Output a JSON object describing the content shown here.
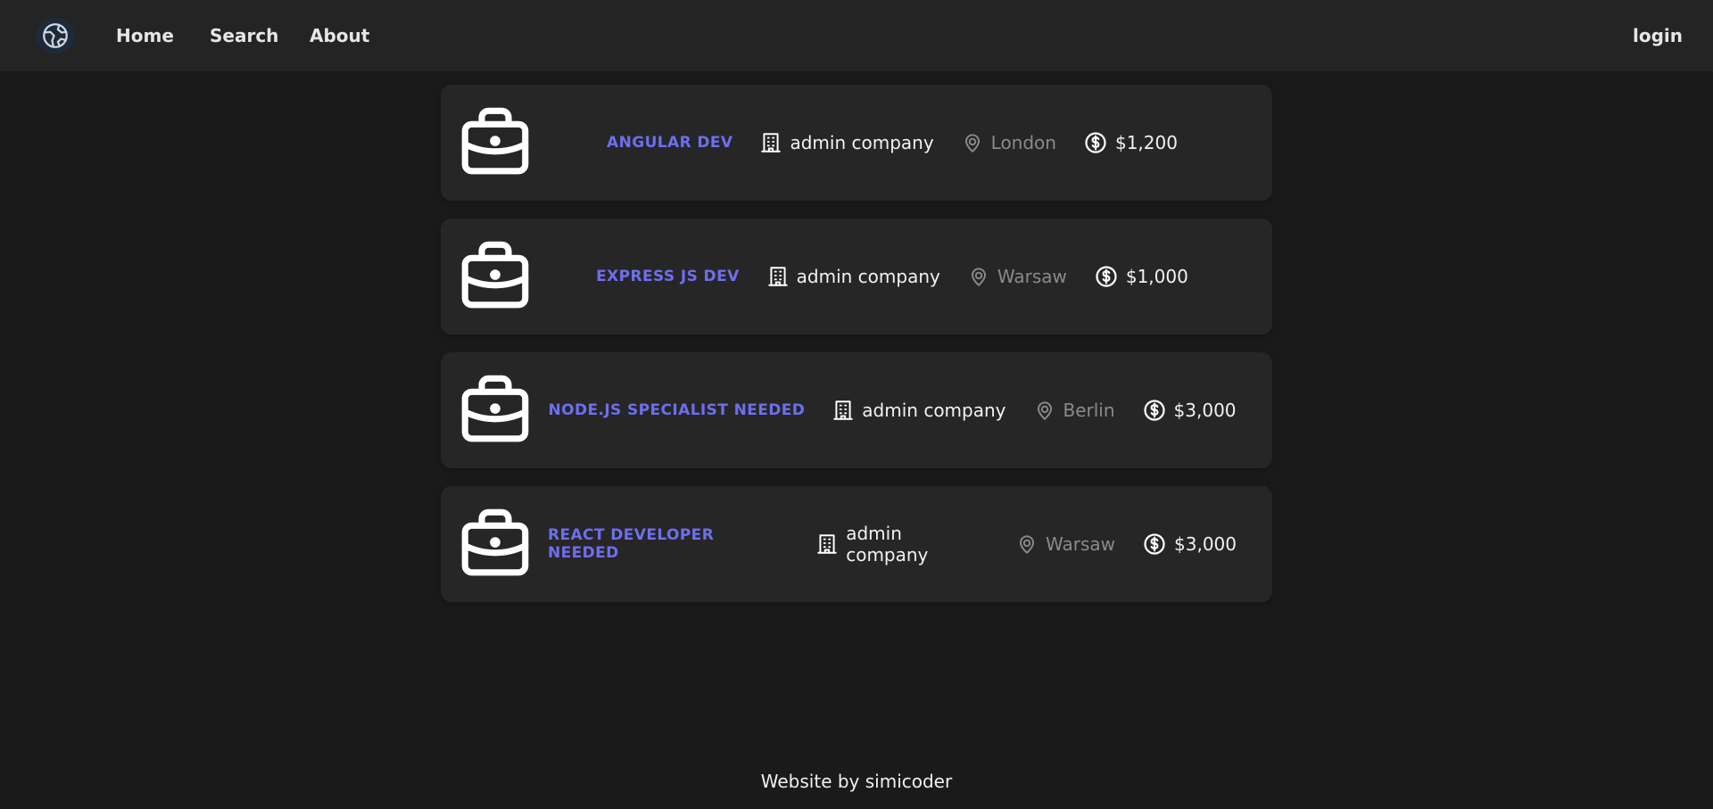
{
  "nav": {
    "logo_icon": "globe-logo-icon",
    "home": "Home",
    "search": "Search",
    "about": "About",
    "login": "login"
  },
  "jobs": [
    {
      "title": "ANGULAR DEV",
      "company": "admin company",
      "location": "London",
      "salary": "$1,200"
    },
    {
      "title": "EXPRESS JS DEV",
      "company": "admin company",
      "location": "Warsaw",
      "salary": "$1,000"
    },
    {
      "title": "NODE.JS SPECIALIST NEEDED",
      "company": "admin company",
      "location": "Berlin",
      "salary": "$3,000"
    },
    {
      "title": "REACT DEVELOPER NEEDED",
      "company": "admin company",
      "location": "Warsaw",
      "salary": "$3,000"
    }
  ],
  "footer": {
    "text": "Website by simicoder"
  },
  "colors": {
    "accent": "#6e6ef0",
    "background": "#1a1a1a",
    "card": "#262626",
    "muted": "#8a8a8a"
  }
}
